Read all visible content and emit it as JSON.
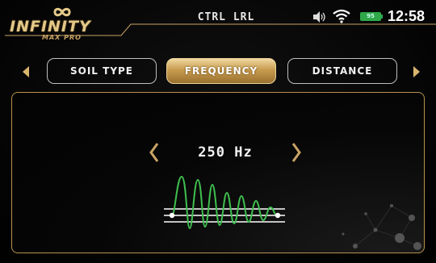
{
  "header": {
    "logo_text": "INFINITY",
    "logo_sub": "MAX PRO",
    "title": "CTRL LRL",
    "battery_level": "95",
    "time": "12:58"
  },
  "tabs": [
    {
      "label": "SOIL TYPE",
      "active": false
    },
    {
      "label": "FREQUENCY",
      "active": true
    },
    {
      "label": "DISTANCE",
      "active": false
    }
  ],
  "panel": {
    "frequency_value": "250 Hz"
  },
  "colors": {
    "accent_gold": "#c9a466",
    "wave_green": "#3fbf4f",
    "battery_green": "#2fa84a"
  },
  "icons": [
    "infinity-icon",
    "speaker-icon",
    "wifi-icon",
    "battery-icon",
    "chevron-left-icon",
    "chevron-right-icon",
    "waveform-icon"
  ]
}
